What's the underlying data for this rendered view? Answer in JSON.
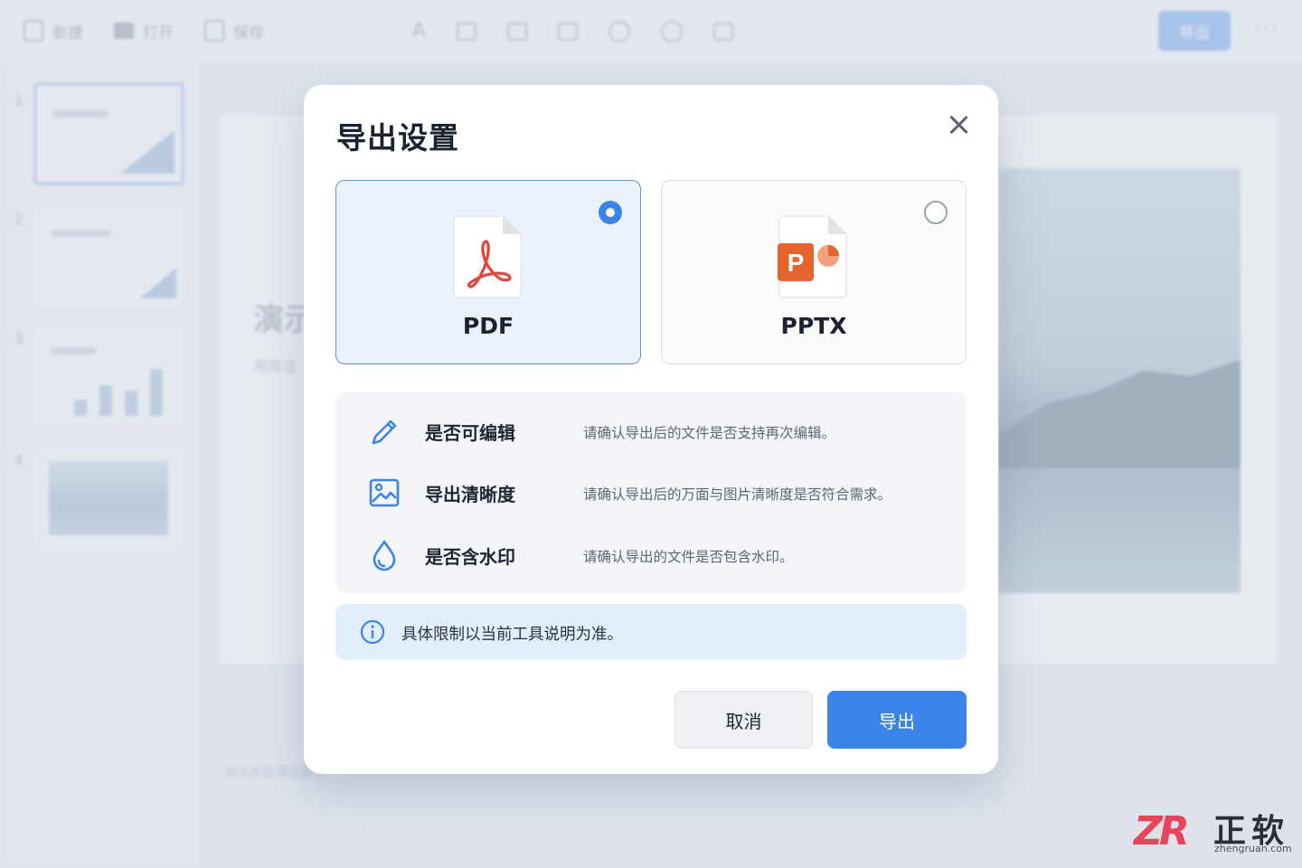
{
  "toolbar": {
    "new_label": "新建",
    "open_label": "打开",
    "save_label": "保存",
    "font_glyph": "A",
    "export_label": "导出",
    "more_glyph": "···"
  },
  "sidebar": {
    "slides": [
      {
        "number": "1"
      },
      {
        "number": "2"
      },
      {
        "number": "3"
      },
      {
        "number": "4"
      }
    ]
  },
  "canvas": {
    "title_partial": "演示",
    "subtitle_partial": "用简洁",
    "notes_placeholder": "单击此处添加备注"
  },
  "dialog": {
    "title": "导出设置",
    "formats": [
      {
        "label": "PDF",
        "selected": true,
        "icon": "pdf-file-icon",
        "accent": "#e2463a"
      },
      {
        "label": "PPTX",
        "selected": false,
        "icon": "pptx-file-icon",
        "accent": "#e4652e"
      }
    ],
    "options": [
      {
        "icon": "pencil-icon",
        "label": "是否可编辑",
        "description": "请确认导出后的文件是否支持再次编辑。"
      },
      {
        "icon": "image-icon",
        "label": "导出清晰度",
        "description": "请确认导出后的万面与图片清晰度是否符合需求。"
      },
      {
        "icon": "water-drop-icon",
        "label": "是否含水印",
        "description": "请确认导出的文件是否包含水印。"
      }
    ],
    "notice": "具体限制以当前工具说明为准。",
    "cancel_label": "取消",
    "confirm_label": "导出"
  },
  "watermark": {
    "logo": "ZR",
    "name": "正软",
    "url": "zhengruan.com"
  },
  "colors": {
    "accent": "#3a84ea",
    "selected_bg": "#eaf2fe",
    "notice_bg": "#e3eefc"
  }
}
